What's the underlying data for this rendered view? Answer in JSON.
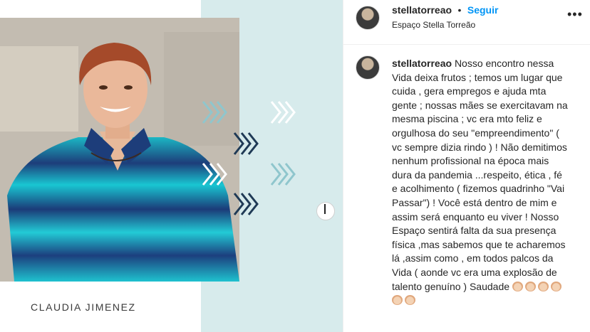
{
  "post": {
    "image_caption": "CLAUDIA JIMENEZ",
    "icons": [
      "chevron-triple-icon",
      "cursor-icon"
    ],
    "colors": {
      "panel": "#d7ebec",
      "chevron_dark": "#1f3a56",
      "chevron_light": "#7fb6c0",
      "follow": "#0095f6"
    }
  },
  "header": {
    "username": "stellatorreao",
    "separator": "•",
    "follow_label": "Seguir",
    "location": "Espaço Stella Torreão",
    "more_label": "•••"
  },
  "comment": {
    "username": "stellatorreao",
    "text": "Nosso encontro nessa Vida deixa frutos ; temos um lugar que cuida , gera empregos e ajuda mta gente ; nossas mães se exercitavam na mesma piscina ; vc era mto feliz e orgulhosa do seu \"empreendimento\" ( vc sempre dizia rindo ) ! Não demitimos nenhum profissional na época mais dura da pandemia ...respeito, ética , fé e acolhimento ( fizemos quadrinho \"Vai Passar\") ! Você está dentro de mim e assim será enquanto eu viver ! Nosso Espaço sentirá falta da sua presença física ,mas sabemos que te acharemos lá ,assim como , em todos palcos da Vida ( aonde vc era uma explosão de talento genuíno ) Saudade",
    "emoji_icon": "clapping-hands-icon"
  }
}
